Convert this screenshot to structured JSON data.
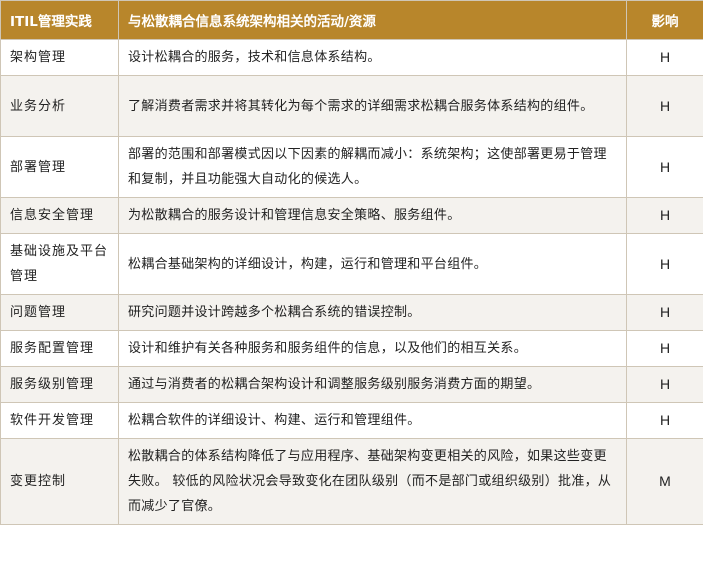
{
  "table": {
    "headers": {
      "practice": "ITIL管理实践",
      "activity": "与松散耦合信息系统架构相关的活动/资源",
      "impact": "影响"
    },
    "rows": [
      {
        "practice": "架构管理",
        "activity": "设计松耦合的服务，技术和信息体系结构。",
        "impact": "H"
      },
      {
        "practice": "业务分析",
        "activity": "了解消费者需求并将其转化为每个需求的详细需求松耦合服务体系结构的组件。",
        "impact": "H"
      },
      {
        "practice": "部署管理",
        "activity": "部署的范围和部署模式因以下因素的解耦而减小：系统架构；这使部署更易于管理和复制，并且功能强大自动化的候选人。",
        "impact": "H"
      },
      {
        "practice": "信息安全管理",
        "activity": "为松散耦合的服务设计和管理信息安全策略、服务组件。",
        "impact": "H"
      },
      {
        "practice": "基础设施及平台管理",
        "activity": "松耦合基础架构的详细设计，构建，运行和管理和平台组件。",
        "impact": "H"
      },
      {
        "practice": "问题管理",
        "activity": "研究问题并设计跨越多个松耦合系统的错误控制。",
        "impact": "H"
      },
      {
        "practice": "服务配置管理",
        "activity": "设计和维护有关各种服务和服务组件的信息，以及他们的相互关系。",
        "impact": "H"
      },
      {
        "practice": "服务级别管理",
        "activity": "通过与消费者的松耦合架构设计和调整服务级别服务消费方面的期望。",
        "impact": "H"
      },
      {
        "practice": "软件开发管理",
        "activity": "松耦合软件的详细设计、构建、运行和管理组件。",
        "impact": "H"
      },
      {
        "practice": "变更控制",
        "activity": "松散耦合的体系结构降低了与应用程序、基础架构变更相关的风险，如果这些变更失败。 较低的风险状况会导致变化在团队级别（而不是部门或组织级别）批准，从而减少了官僚。",
        "impact": "M"
      }
    ]
  }
}
